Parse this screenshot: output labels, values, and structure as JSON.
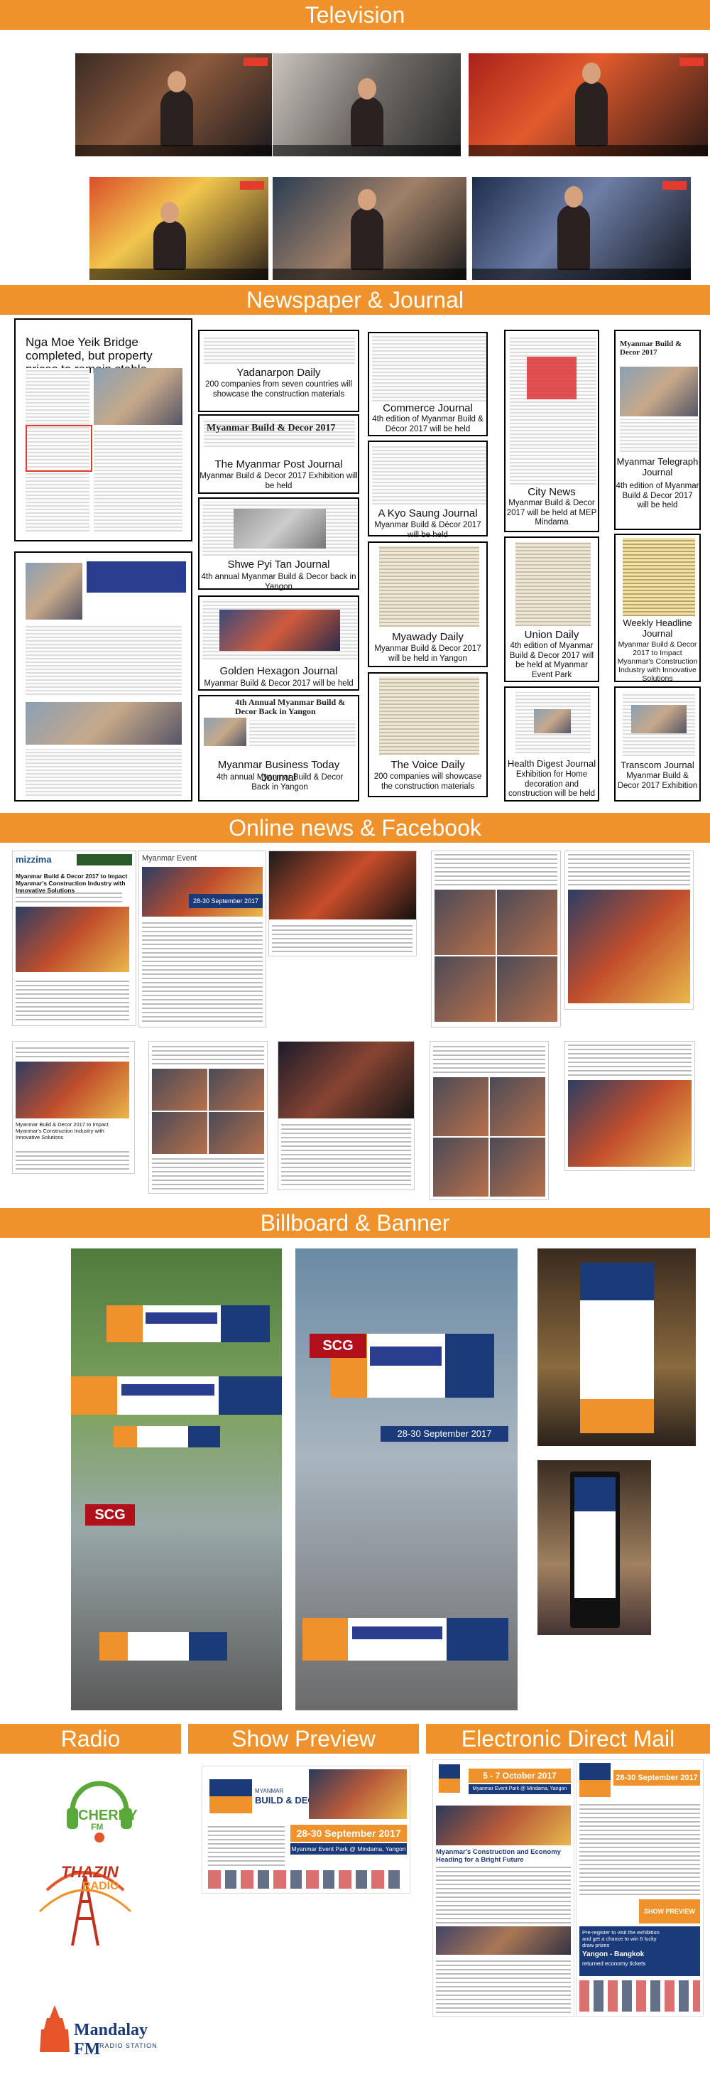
{
  "sections": {
    "television": "Television",
    "newspaper": "Newspaper & Journal",
    "online": "Online news & Facebook",
    "billboard": "Billboard & Banner",
    "radio": "Radio",
    "show_preview": "Show Preview",
    "edm": "Electronic Direct Mail"
  },
  "tv": {
    "stills": [
      "mitv",
      "mitv",
      "mitv",
      "mitv",
      "mitv",
      "mitv"
    ]
  },
  "newspapers": {
    "col1_top": {
      "headline": "Nga Moe Yeik Bridge completed, but property prices to remain stable"
    },
    "yadanarpon": {
      "title": "Yadanarpon Daily",
      "desc": "200 companies from seven countries will showcase the construction materials"
    },
    "myanmar_post": {
      "masthead": "Myanmar Build & Decor 2017",
      "title": "The Myanmar Post Journal",
      "desc": "Myanmar Build & Decor 2017 Exhibition will be held"
    },
    "shwe_pyi_tan": {
      "title": "Shwe Pyi Tan Journal",
      "desc": "4th  annual Myanmar Build & Decor back in Yangon"
    },
    "golden_hexagon": {
      "title": "Golden Hexagon Journal",
      "desc": "Myanmar Build & Decor 2017 will be held"
    },
    "myanmar_business_today": {
      "masthead": "4th Annual Myanmar Build & Decor Back in Yangon",
      "title": "Myanmar Business Today Journal",
      "desc": "4th  annual Myanmar Build & Decor Back in Yangon"
    },
    "commerce": {
      "title": "Commerce Journal",
      "desc": "4th edition of Myanmar Build & Décor 2017 will be held"
    },
    "a_kyo_saung": {
      "title": "A Kyo Saung Journal",
      "desc": "Myanmar Build & Décor 2017 will be held"
    },
    "myawady": {
      "title": "Myawady Daily",
      "desc": "Myanmar Build & Decor 2017 will be held in Yangon"
    },
    "voice": {
      "title": "The Voice Daily",
      "desc": "200 companies will showcase the construction materials"
    },
    "city_news": {
      "title": "City News",
      "desc": "Myanmar Build & Decor 2017 will be held at MEP Mindama"
    },
    "union_daily": {
      "title": "Union Daily",
      "desc": "4th  edition of Myanmar Build & Decor 2017 will be held at Myanmar Event Park"
    },
    "health_digest": {
      "title": "Health Digest Journal",
      "desc": "Exhibition for Home decoration and construction will be held"
    },
    "myanmar_telegraph": {
      "masthead": "Myanmar Build & Decor 2017",
      "title": "Myanmar Telegraph Journal",
      "desc": "4th edition of Myanmar Build & Decor 2017 will be held"
    },
    "weekly_headline": {
      "title": "Weekly Headline Journal",
      "desc": "Myanmar Build & Decor 2017 to Impact Myanmar's Construction Industry with Innovative Solutions"
    },
    "transcom": {
      "title": "Transcom Journal",
      "desc": "Myanmar Build & Decor 2017 Exhibition"
    }
  },
  "online": {
    "mizzima_brand": "mizzima",
    "mizzima_headline": "Myanmar Build & Decor 2017 to Impact Myanmar's Construction Industry with Innovative Solutions",
    "event_brand": "Myanmar Event",
    "event_dates": "28-30 September 2017",
    "eleven_headline": "Myanmar Build & Decor 2017 to Impact Myanmar's Construction Industry with Innovative Solutions"
  },
  "billboard": {
    "dates": "28-30 September 2017",
    "scg": "SCG"
  },
  "radio": {
    "cherry_name": "CHERRY",
    "cherry_fm": "FM",
    "thazin": "THAZIN",
    "thazin_sub": "RADIO",
    "mandalay": "Mandalay FM",
    "mandalay_sub": "RADIO STATION"
  },
  "show_preview": {
    "brand_top": "MYANMAR",
    "brand": "BUILD & DECOR",
    "dates": "28-30 September 2017",
    "venue": "Myanmar Event Park @ Mindama, Yangon"
  },
  "edm": {
    "dates_a": "5 - 7 October  2017",
    "venue_a": "Myanmar Event Park @ Mindama, Yangon",
    "headline_a": "Myanmar's Construction and Economy Heading for a Bright Future",
    "dates_b": "28-30 September 2017",
    "show_preview": "SHOW PREVIEW 2017",
    "banner_b": "Pre-register to visit the exhibition and get a chance to win 6 lucky draw prizes",
    "route_b": "Yangon - Bangkok",
    "route_sub": "returned economy tickets"
  },
  "colors": {
    "orange": "#f0922b",
    "navy": "#1b3a7a",
    "red": "#b10f1a"
  }
}
